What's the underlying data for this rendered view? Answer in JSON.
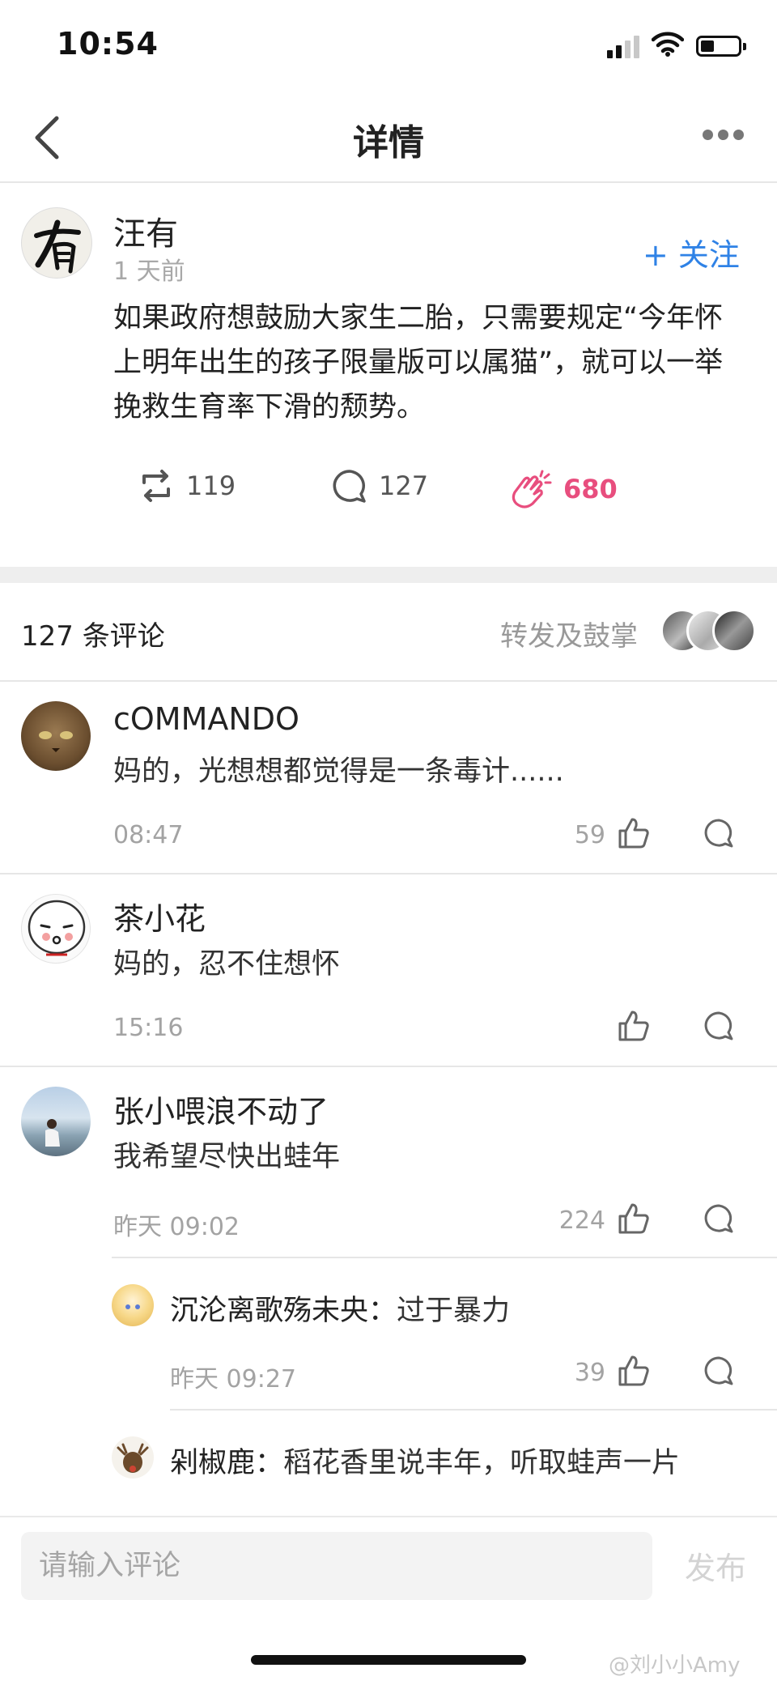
{
  "status": {
    "time": "10:54"
  },
  "nav": {
    "title": "详情"
  },
  "post": {
    "author": "汪有",
    "time": "1 天前",
    "follow": "+ 关注",
    "body": "如果政府想鼓励大家生二胎，只需要规定“今年怀上明年出生的孩子限量版可以属猫”，就可以一举挽救生育率下滑的颓势。",
    "reposts": "119",
    "comments": "127",
    "claps": "680"
  },
  "comments_header": {
    "count_label": "127 条评论",
    "reposts_label": "转发及鼓掌"
  },
  "comments": [
    {
      "name": "cOMMANDO",
      "text": "妈的，光想想都觉得是一条毒计......",
      "time": "08:47",
      "likes": "59"
    },
    {
      "name": "茶小花",
      "text": "妈的，忍不住想怀",
      "time": "15:16",
      "likes": ""
    },
    {
      "name": "张小喂浪不动了",
      "text": "我希望尽快出蛙年",
      "time": "昨天 09:02",
      "likes": "224"
    }
  ],
  "replies": [
    {
      "name": "沉沦离歌殇未央：",
      "text": "过于暴力",
      "time": "昨天 09:27",
      "likes": "39"
    },
    {
      "name": "剁椒鹿：",
      "text": "稻花香里说丰年，听取蛙声一片"
    }
  ],
  "input": {
    "placeholder": "请输入评论",
    "send": "发布"
  },
  "watermark": "@刘小小Amy",
  "colors": {
    "accent": "#2f82e6",
    "clap": "#e84e7e"
  }
}
